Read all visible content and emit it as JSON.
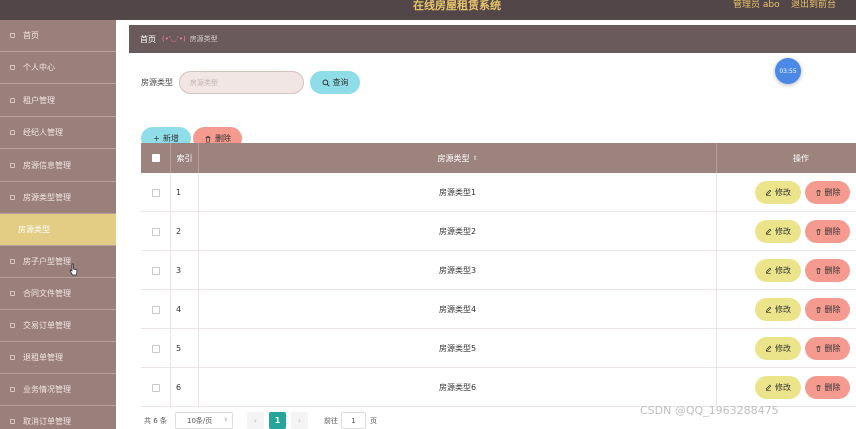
{
  "header": {
    "title": "在线房屋租赁系统",
    "admin": "管理员 abo",
    "logout": "退出到前台"
  },
  "sidebar": {
    "items": [
      {
        "label": "首页"
      },
      {
        "label": "个人中心"
      },
      {
        "label": "租户管理"
      },
      {
        "label": "经纪人管理"
      },
      {
        "label": "房源信息管理"
      },
      {
        "label": "房源类型管理"
      },
      {
        "label": "房源类型",
        "active": true
      },
      {
        "label": "房子户型管理"
      },
      {
        "label": "合同文件管理"
      },
      {
        "label": "交易订单管理"
      },
      {
        "label": "退租单管理"
      },
      {
        "label": "业务情况管理"
      },
      {
        "label": "取消订单管理"
      }
    ]
  },
  "breadcrumb": {
    "home": "首页",
    "face": "(•'◡'•)",
    "current": "房源类型"
  },
  "search": {
    "label": "房源类型",
    "placeholder": "房源类型",
    "query_button": "查询",
    "query_icon": "search-icon"
  },
  "actions": {
    "add_label": "新增",
    "delete_label": "删除"
  },
  "timer": "03:55",
  "table": {
    "columns": [
      "索引",
      "房源类型",
      "操作"
    ],
    "sort_icon": "sort-icon",
    "rows": [
      {
        "index": "1",
        "type": "房源类型1"
      },
      {
        "index": "2",
        "type": "房源类型2"
      },
      {
        "index": "3",
        "type": "房源类型3"
      },
      {
        "index": "4",
        "type": "房源类型4"
      },
      {
        "index": "5",
        "type": "房源类型5"
      },
      {
        "index": "6",
        "type": "房源类型6"
      }
    ],
    "edit_label": "修改",
    "delete_label": "删除"
  },
  "pagination": {
    "total": "共 6 条",
    "page_size": "10条/页",
    "current_page": "1",
    "goto_prefix": "前往",
    "goto_value": "1",
    "goto_suffix": "页"
  },
  "watermark": "CSDN @QQ_1963288475",
  "colors": {
    "topbar": "#524649",
    "sidebar": "#9a7f7b",
    "sidebar_active": "#e3cc84",
    "accent_cyan": "#8fdde8",
    "accent_red": "#f59a8f",
    "accent_yellow": "#ece48a",
    "table_header": "#9c837e",
    "page_active": "#26a69a"
  }
}
